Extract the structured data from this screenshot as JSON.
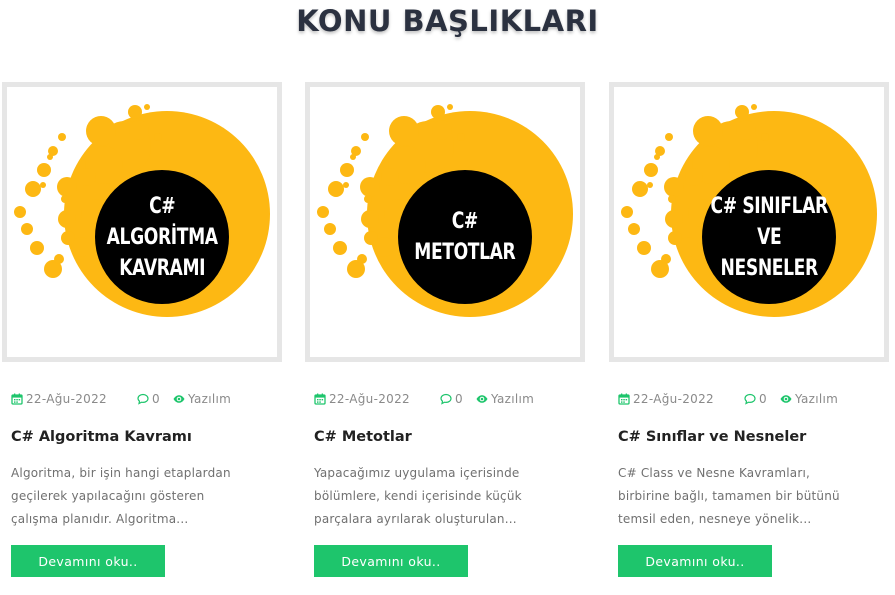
{
  "section": {
    "title": "KONU BAŞLIKLARI"
  },
  "colors": {
    "accent": "#1ec56c",
    "brand_yellow": "#fdb813",
    "thumb_dark": "#000000"
  },
  "icons": {
    "date": "calendar-icon",
    "comments": "comment-icon",
    "category": "eye-icon"
  },
  "cards": [
    {
      "image_text": "C#\nALGORİTMA\nKAVRAMI",
      "date": "22-Ağu-2022",
      "comments": "0",
      "category": "Yazılım",
      "title": "C# Algoritma Kavramı",
      "excerpt": [
        "Algoritma, bir işin hangi etaplardan",
        "geçilerek yapılacağını gösteren",
        "çalışma planıdır. Algoritma..."
      ],
      "button": "Devamını oku.."
    },
    {
      "image_text": "C#\nMETOTLAR",
      "date": "22-Ağu-2022",
      "comments": "0",
      "category": "Yazılım",
      "title": "C# Metotlar",
      "excerpt": [
        "Yapacağımız uygulama içerisinde",
        "bölümlere, kendi içerisinde küçük",
        "parçalara ayrılarak oluşturulan..."
      ],
      "button": "Devamını oku.."
    },
    {
      "image_text": "C# SINIFLAR\nVE\nNESNELER",
      "date": "22-Ağu-2022",
      "comments": "0",
      "category": "Yazılım",
      "title": "C# Sınıflar ve Nesneler",
      "excerpt": [
        "C# Class ve Nesne Kavramları,",
        "birbirine bağlı, tamamen bir bütünü",
        "temsil eden, nesneye yönelik..."
      ],
      "button": "Devamını oku.."
    }
  ]
}
